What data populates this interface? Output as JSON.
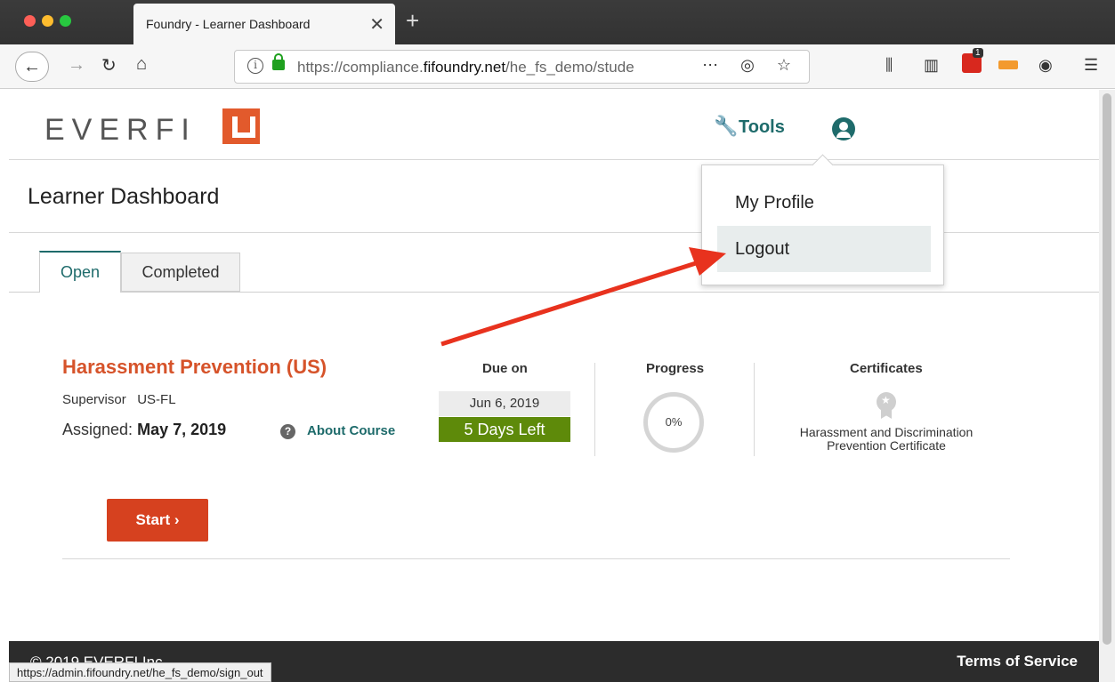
{
  "browser": {
    "tab_title": "Foundry - Learner Dashboard",
    "close_glyph": "✕",
    "new_tab_glyph": "+",
    "url_prefix": "https://compliance.",
    "url_domain": "fifoundry.net",
    "url_path": "/he_fs_demo/stude",
    "status_url": "https://admin.fifoundry.net/he_fs_demo/sign_out",
    "notification_count": "1"
  },
  "header": {
    "logo_text": "EVERFI",
    "tools_label": "Tools"
  },
  "page": {
    "title": "Learner Dashboard",
    "tabs": [
      {
        "label": "Open",
        "active": true
      },
      {
        "label": "Completed",
        "active": false
      }
    ]
  },
  "course": {
    "title": "Harassment Prevention (US)",
    "role": "Supervisor",
    "region": "US-FL",
    "assigned_label": "Assigned:",
    "assigned_date": "May 7, 2019",
    "about_label": "About Course",
    "due_header": "Due on",
    "due_date": "Jun 6, 2019",
    "days_left": "5 Days Left",
    "progress_header": "Progress",
    "progress_value": "0%",
    "certificates_header": "Certificates",
    "certificate_name": "Harassment and Discrimination Prevention Certificate",
    "start_label": "Start  ›"
  },
  "dropdown": {
    "items": [
      {
        "label": "My Profile"
      },
      {
        "label": "Logout"
      }
    ]
  },
  "footer": {
    "copyright": "© 2019 EVERFI Inc.",
    "terms": "Terms of Service"
  },
  "colors": {
    "accent": "#1e6b6b",
    "brand_orange": "#d6532a",
    "due_green": "#5e8a0a",
    "annotation_arrow": "#e8321e"
  }
}
